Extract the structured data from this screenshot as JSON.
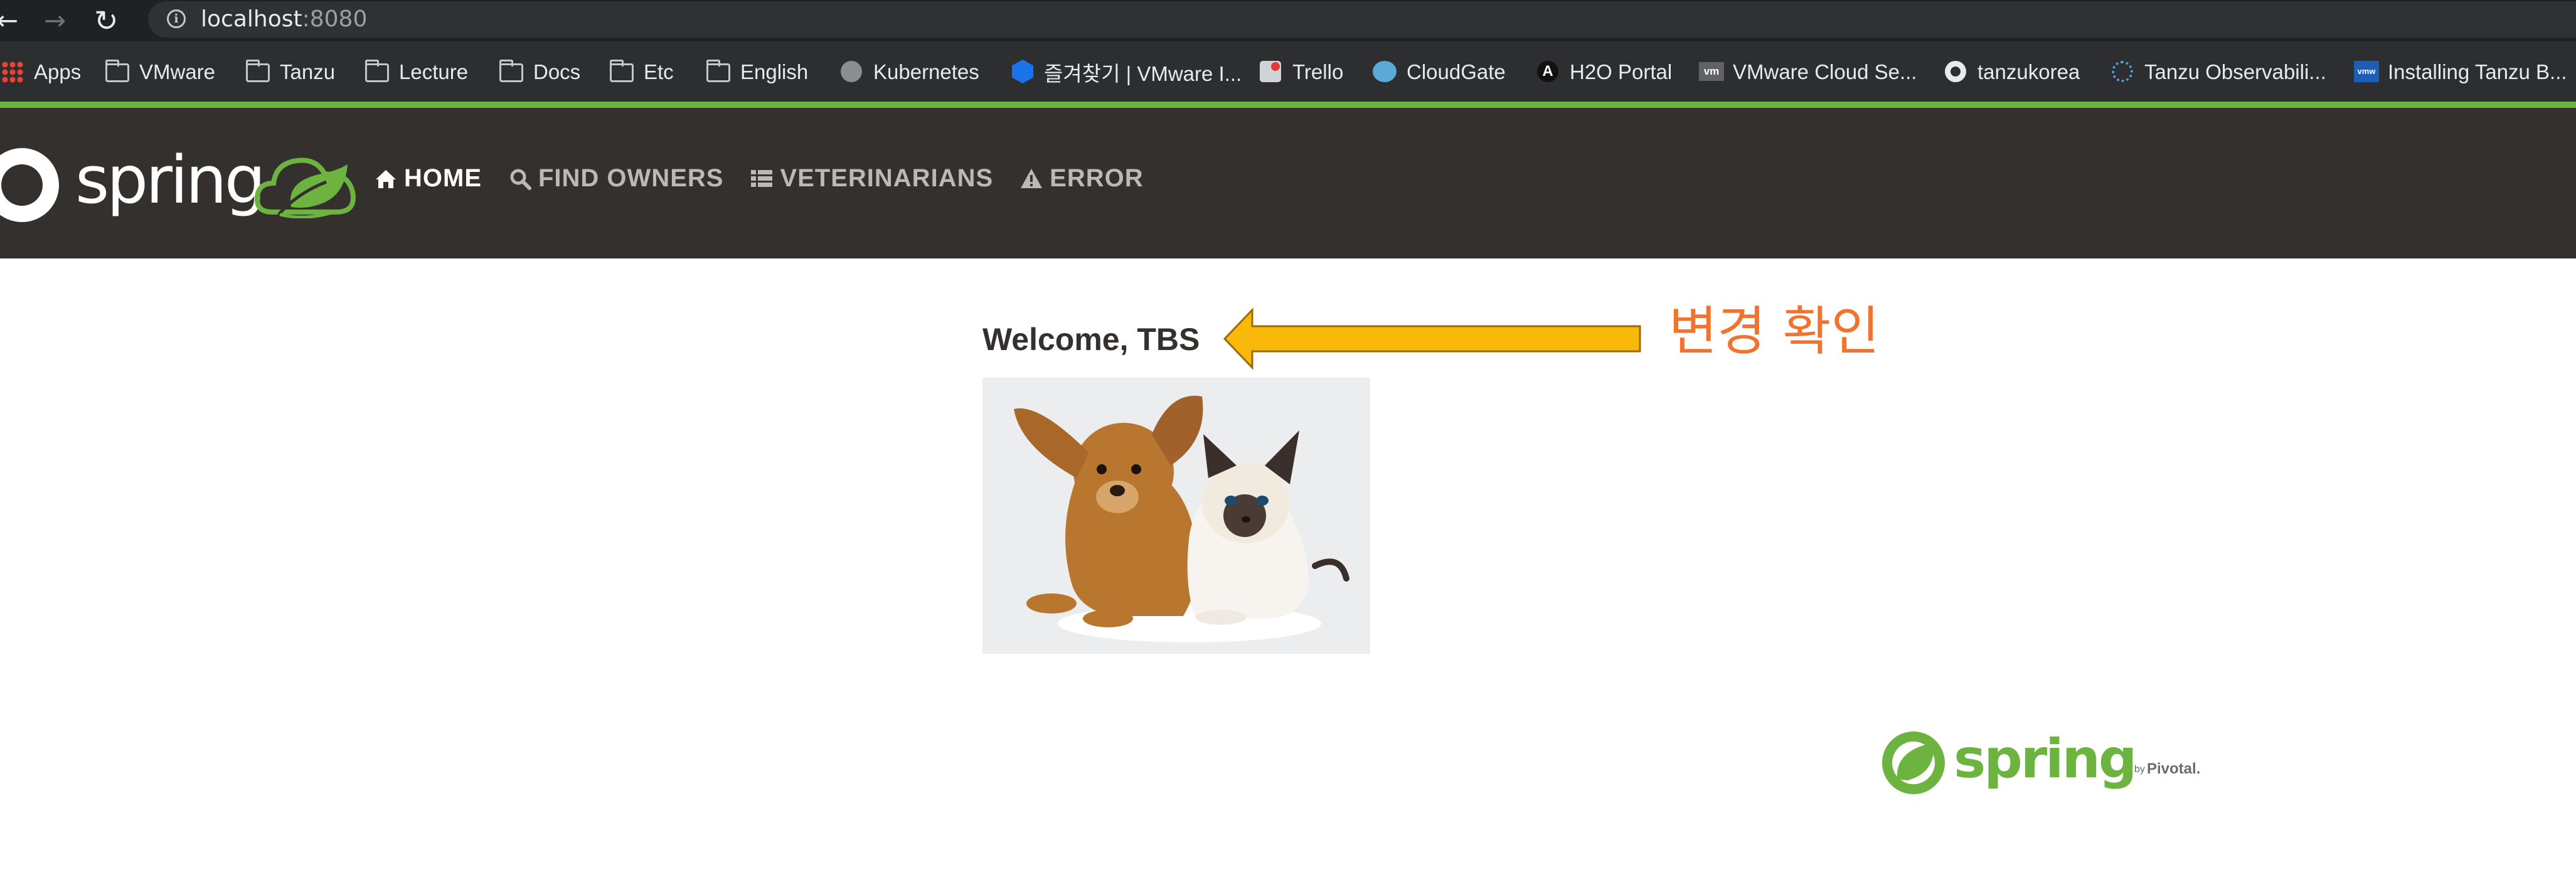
{
  "browser": {
    "url_host": "localhost",
    "url_port": ":8080",
    "bookmarks": [
      {
        "label": "Apps",
        "icon": "apps-grid-icon"
      },
      {
        "label": "VMware",
        "icon": "folder-icon"
      },
      {
        "label": "Tanzu",
        "icon": "folder-icon"
      },
      {
        "label": "Lecture",
        "icon": "folder-icon"
      },
      {
        "label": "Docs",
        "icon": "folder-icon"
      },
      {
        "label": "Etc",
        "icon": "folder-icon"
      },
      {
        "label": "English",
        "icon": "folder-icon"
      },
      {
        "label": "Kubernetes",
        "icon": "globe-icon"
      },
      {
        "label": "즐겨찾기 | VMware I...",
        "icon": "vmware-hex-icon"
      },
      {
        "label": "Trello",
        "icon": "trello-icon"
      },
      {
        "label": "CloudGate",
        "icon": "cloudgate-icon"
      },
      {
        "label": "H2O Portal",
        "icon": "h2o-icon"
      },
      {
        "label": "VMware Cloud Se...",
        "icon": "vm-icon"
      },
      {
        "label": "tanzukorea",
        "icon": "github-icon"
      },
      {
        "label": "Tanzu Observabili...",
        "icon": "tanzu-ring-icon"
      },
      {
        "label": "Installing Tanzu B...",
        "icon": "vmw-icon"
      }
    ]
  },
  "navbar": {
    "logo_text": "spring",
    "items": [
      {
        "label": "HOME",
        "icon": "home-icon",
        "active": true
      },
      {
        "label": "FIND OWNERS",
        "icon": "search-icon",
        "active": false
      },
      {
        "label": "VETERINARIANS",
        "icon": "list-icon",
        "active": false
      },
      {
        "label": "ERROR",
        "icon": "warning-icon",
        "active": false
      }
    ]
  },
  "main": {
    "welcome": "Welcome, TBS",
    "annotation": "변경 확인"
  },
  "footer": {
    "logo_text": "spring",
    "by_text": "by",
    "pivotal_text": "Pivotal."
  },
  "colors": {
    "accent_green": "#6db33f",
    "navbar_bg": "#34302d",
    "arrow_fill": "#f8b90a",
    "annotation": "#f0742f"
  }
}
